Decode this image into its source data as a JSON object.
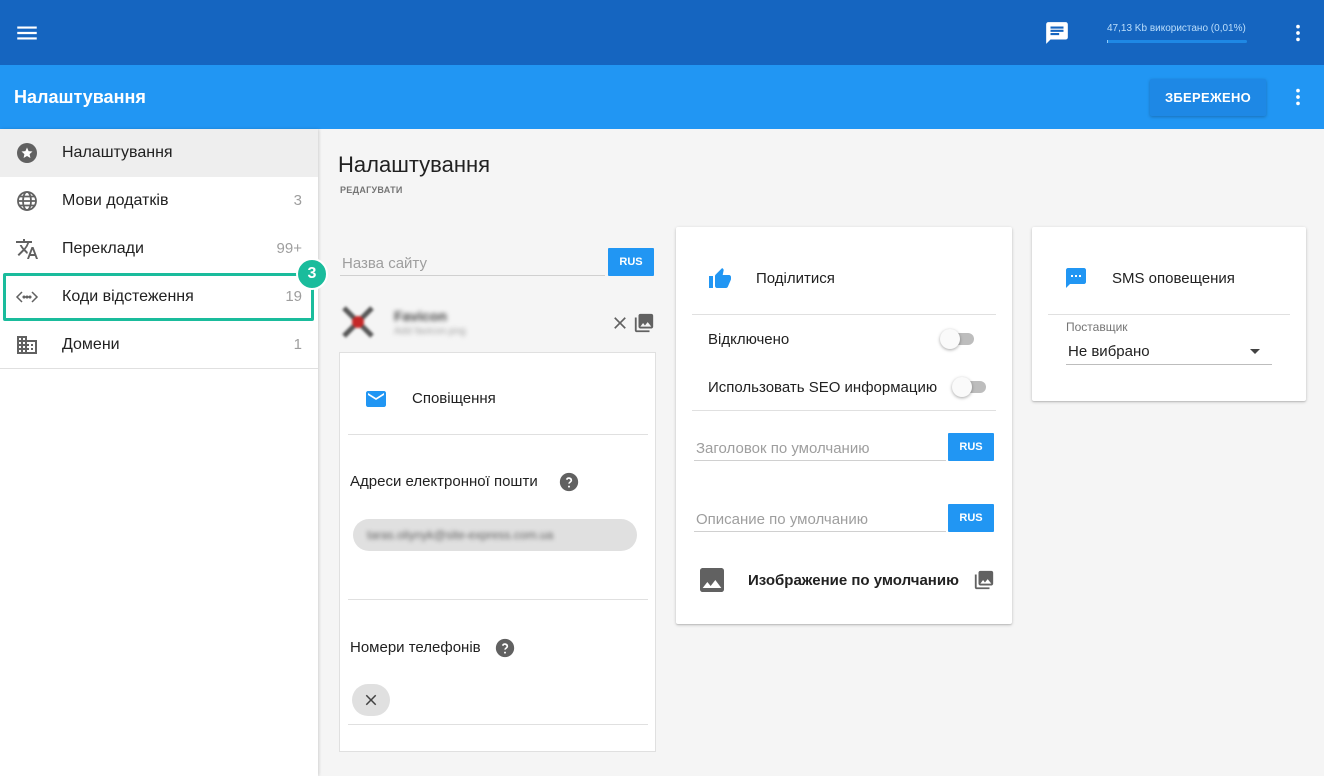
{
  "colors": {
    "topbar": "#1565c0",
    "subbar": "#2196f3",
    "accent": "#2196f3",
    "highlight": "#1abc9c"
  },
  "topbar": {
    "menu_icon": "hamburger-menu-icon",
    "chat_icon": "message-icon",
    "usage_text": "47,13 Kb використано (0,01%)",
    "usage_fraction": 0.0001,
    "more_icon": "more-vertical-icon"
  },
  "subbar": {
    "title": "Налаштування",
    "save_label": "ЗБЕРЕЖЕНО",
    "more_icon": "more-vertical-icon"
  },
  "sidebar": {
    "items": [
      {
        "label": "Налаштування",
        "count": "",
        "icon": "star-circle-icon",
        "active": true
      },
      {
        "label": "Мови додатків",
        "count": "3",
        "icon": "globe-icon",
        "active": false
      },
      {
        "label": "Переклади",
        "count": "99+",
        "icon": "translate-icon",
        "active": false
      },
      {
        "label": "Коди відстеження",
        "count": "19",
        "icon": "code-icon",
        "active": false
      },
      {
        "label": "Домени",
        "count": "1",
        "icon": "domain-icon",
        "active": false
      }
    ],
    "step_badge": "3"
  },
  "main": {
    "title": "Налаштування",
    "subtitle": "РЕДАГУВАТИ",
    "site_name_placeholder": "Назва сайту",
    "lang_button": "RUS",
    "favicon": {
      "name": "Favicon",
      "sub": "Add favicon.png"
    },
    "notifications": {
      "title": "Сповіщення",
      "email_label": "Адреси електронної пошти",
      "email_value": "taras.oliynyk@site-express.com.ua",
      "phone_label": "Номери телефонів"
    }
  },
  "share": {
    "title": "Поділитися",
    "disabled_label": "Відключено",
    "seo_label": "Использовать SEO информацию",
    "default_title_placeholder": "Заголовок по умолчанию",
    "default_desc_placeholder": "Описание по умолчанию",
    "lang_button": "RUS",
    "default_image_label": "Изображение по умолчанию"
  },
  "sms": {
    "title": "SMS оповещения",
    "provider_label": "Поставщик",
    "provider_value": "Не вибрано"
  }
}
